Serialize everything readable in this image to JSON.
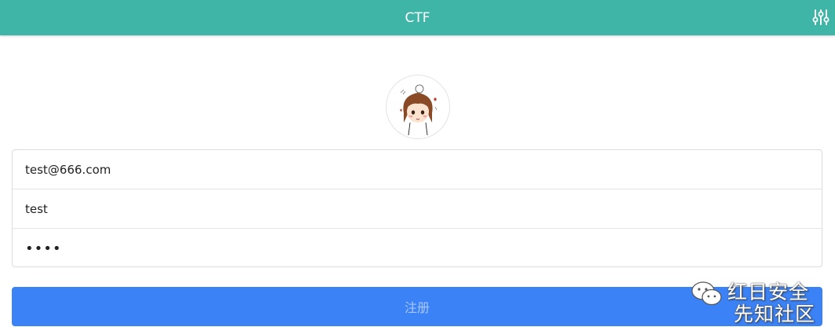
{
  "header": {
    "title": "CTF",
    "settings_icon": "sliders-icon"
  },
  "avatar": {
    "icon": "cartoon-girl-avatar"
  },
  "form": {
    "email_value": "test@666.com",
    "username_value": "test",
    "password_value": "••••"
  },
  "submit": {
    "label": "注册"
  },
  "watermark": {
    "line1": "红日安全",
    "line2": "先知社区",
    "icon": "wechat-icon"
  },
  "colors": {
    "header_bg": "#3eb5a6",
    "button_bg": "#3b82f6"
  }
}
